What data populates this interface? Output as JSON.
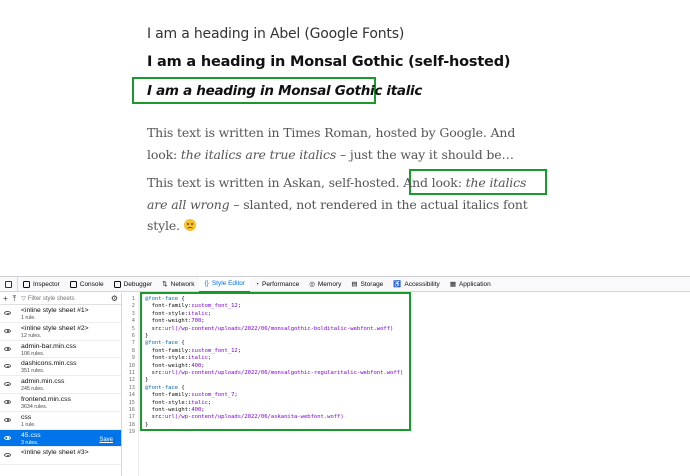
{
  "preview": {
    "heading_abel": "I am a heading in Abel (Google Fonts)",
    "heading_bold": "I am a heading in Monsal Gothic (self-hosted)",
    "heading_italic": "I am a heading in Monsal Gothic italic",
    "para1_a": "This text is written in Times Roman, hosted by Google. And look: ",
    "para1_em": "the italics are true italics",
    "para1_b": " – just the way it should be…",
    "para2_a": "This text is written in Askan, self-hosted. And look: ",
    "para2_em": "the italics are all wrong",
    "para2_b": " – slanted, not rendered in the actual italics font style. "
  },
  "devtools": {
    "tabs": [
      {
        "label": "Inspector"
      },
      {
        "label": "Console"
      },
      {
        "label": "Debugger"
      },
      {
        "label": "Network"
      },
      {
        "label": "Style Editor"
      },
      {
        "label": "Performance"
      },
      {
        "label": "Memory"
      },
      {
        "label": "Storage"
      },
      {
        "label": "Accessibility"
      },
      {
        "label": "Application"
      }
    ],
    "active_tab": "Style Editor",
    "toolbar": {
      "add_icon": "+",
      "import_icon": "⤒",
      "filter_placeholder": "Filter style sheets",
      "settings_icon": "⚙"
    },
    "sheets": [
      {
        "name": "<inline style sheet #1>",
        "rules": "1 rule."
      },
      {
        "name": "<inline style sheet #2>",
        "rules": "12 rules."
      },
      {
        "name": "admin-bar.min.css",
        "rules": "106 rules."
      },
      {
        "name": "dashicons.min.css",
        "rules": "351 rules."
      },
      {
        "name": "admin.min.css",
        "rules": "245 rules."
      },
      {
        "name": "frontend.min.css",
        "rules": "3634 rules."
      },
      {
        "name": "css",
        "rules": "1 rule."
      },
      {
        "name": "45.css",
        "rules": "3 rules.",
        "selected": true
      },
      {
        "name": "<inline style sheet #3>",
        "rules": ""
      }
    ],
    "save_label": "Save",
    "line_numbers": [
      "1",
      "2",
      "3",
      "4",
      "5",
      "6",
      "7",
      "8",
      "9",
      "10",
      "11",
      "12",
      "13",
      "14",
      "15",
      "16",
      "17",
      "18",
      "19"
    ],
    "code": {
      "l1_kw": "@font-face",
      "l1_rest": " {",
      "l2_prop": "  font-family:",
      "l2_val": "custom_font_12",
      "l3_prop": "  font-style:",
      "l3_val": "italic",
      "l4_prop": "  font-weight:",
      "l4_val": "700",
      "l5_prop": "  src:",
      "l5_val": "url(/wp-content/uploads/2022/06/monsalgothic-bolditalic-webfont.woff)",
      "l6": "}",
      "l7_kw": "@font-face",
      "l7_rest": " {",
      "l8_prop": "  font-family:",
      "l8_val": "custom_font_12",
      "l9_prop": "  font-style:",
      "l9_val": "italic",
      "l10_prop": "  font-weight:",
      "l10_val": "400",
      "l11_prop": "  src:",
      "l11_val": "url(/wp-content/uploads/2022/06/monsalgothic-regularitalic-webfont.woff)",
      "l12": "}",
      "l13_kw": "@font-face",
      "l13_rest": " {",
      "l14_prop": "  font-family:",
      "l14_val": "custom_font_7",
      "l15_prop": "  font-style:",
      "l15_val": "italic",
      "l16_prop": "  font-weight:",
      "l16_val": "400",
      "l17_prop": "  src:",
      "l17_val": "url(/wp-content/uploads/2022/06/askanita-webfont.woff)",
      "l18": "}",
      "l19": ""
    }
  },
  "colors": {
    "highlight_box": "#1a9a2a",
    "accent": "#0074e8"
  }
}
